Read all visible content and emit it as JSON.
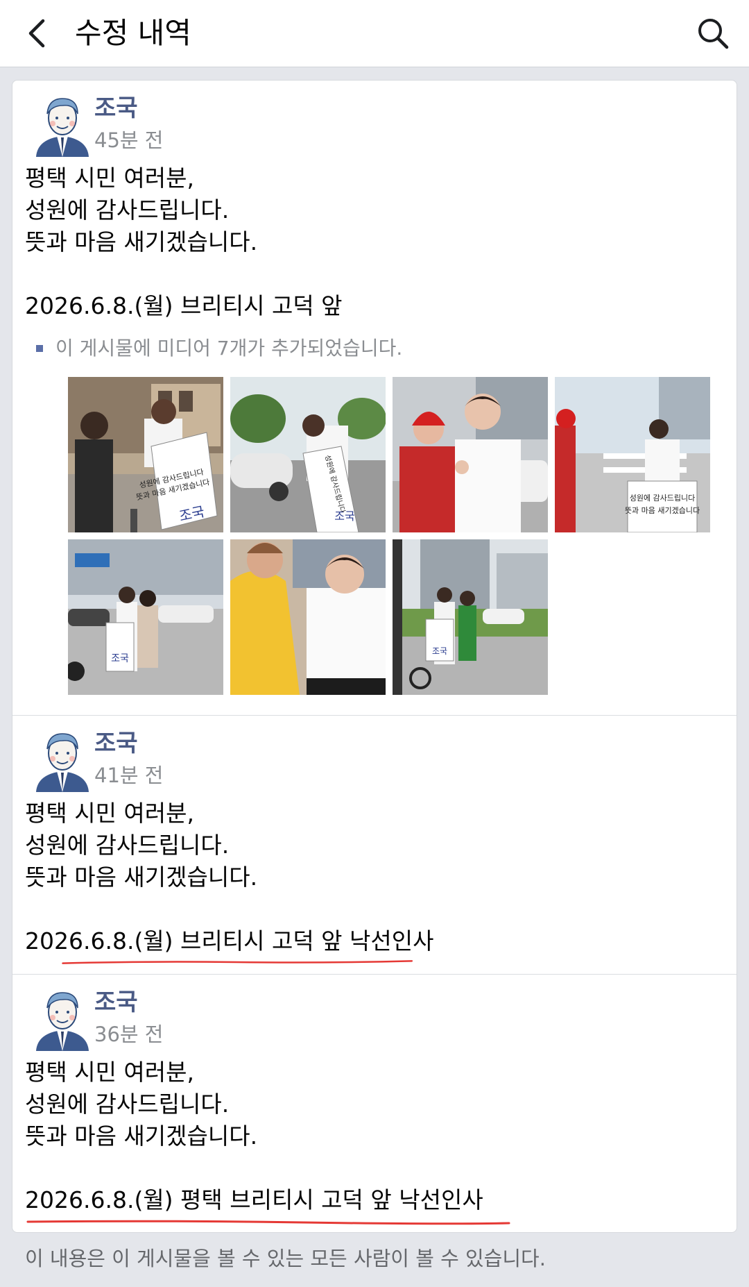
{
  "header": {
    "title": "수정 내역",
    "back_icon": "chevron-left-icon",
    "search_icon": "search-icon"
  },
  "revisions": [
    {
      "author": "조국",
      "time": "45분 전",
      "lines": [
        "평택 시민 여러분,",
        "성원에 감사드립니다.",
        "뜻과 마음 새기겠습니다.",
        "",
        "2026.6.8.(월) 브리티시 고덕 앞"
      ],
      "media_note": "이 게시물에 미디어 7개가 추가되었습니다.",
      "photos": [
        {
          "sign": "성원에 감사드립니다 뜻과 마음 새기겠습니다 조국"
        },
        {
          "sign": "성원에 감사드립니다 뜻과 마음 새기겠습니다 조국"
        },
        {
          "sign": ""
        },
        {
          "sign": "성원에 감사드립니다 뜻과 마음 새기겠습니다"
        },
        {
          "sign": "조국"
        },
        {
          "sign": ""
        },
        {
          "sign": "조국"
        }
      ]
    },
    {
      "author": "조국",
      "time": "41분 전",
      "lines": [
        "평택 시민 여러분,",
        "성원에 감사드립니다.",
        "뜻과 마음 새기겠습니다.",
        "",
        "2026.6.8.(월) 브리티시 고덕 앞 낙선인사"
      ]
    },
    {
      "author": "조국",
      "time": "36분 전",
      "lines": [
        "평택 시민 여러분,",
        "성원에 감사드립니다.",
        "뜻과 마음 새기겠습니다.",
        "",
        "2026.6.8.(월) 평택 브리티시 고덕 앞 낙선인사"
      ]
    }
  ],
  "footer": {
    "note": "이 내용은 이 게시물을 볼 수 있는 모든 사람이 볼 수 있습니다."
  },
  "colors": {
    "author": "#4a5a85",
    "underline": "#e53935",
    "background": "#e4e6eb"
  }
}
